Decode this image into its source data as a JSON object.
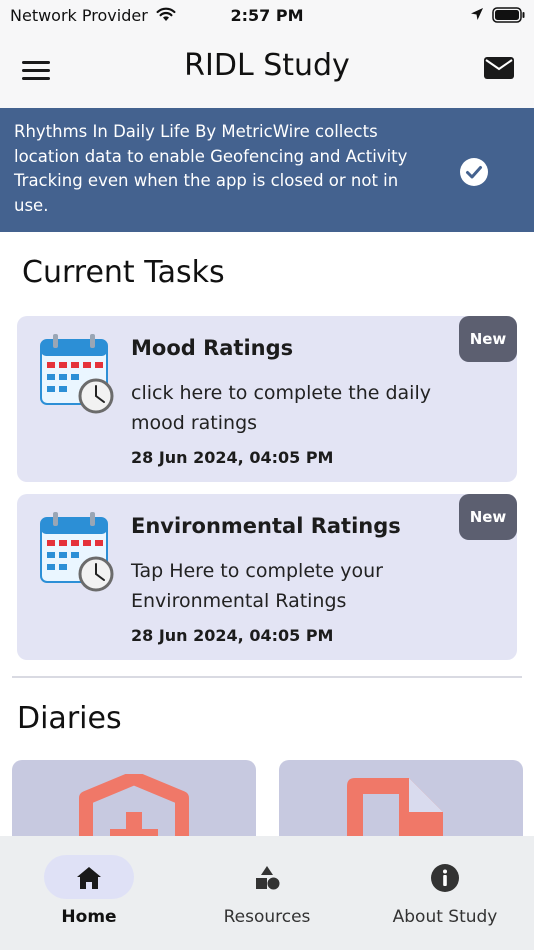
{
  "status_bar": {
    "carrier": "Network Provider",
    "time": "2:57 PM"
  },
  "header": {
    "title": "RIDL Study",
    "menu_icon": "hamburger-menu-icon",
    "mail_icon": "mail-icon"
  },
  "banner": {
    "text": "Rhythms In Daily Life By MetricWire collects location data to enable Geofencing and Activity Tracking even when the app is closed or not in use.",
    "background": "#44628f",
    "icon": "check-circle-icon"
  },
  "current_tasks": {
    "title": "Current Tasks",
    "tasks": [
      {
        "title": "Mood Ratings",
        "description": "click here to complete the daily mood ratings",
        "date": "28 Jun 2024, 04:05 PM",
        "badge": "New",
        "icon": "calendar-clock-icon"
      },
      {
        "title": "Environmental Ratings",
        "description": "Tap Here to complete your Environmental Ratings",
        "date": "28 Jun 2024, 04:05 PM",
        "badge": "New",
        "icon": "calendar-clock-icon"
      }
    ]
  },
  "diaries": {
    "title": "Diaries",
    "items": [
      {
        "icon": "medical-shield-icon"
      },
      {
        "icon": "document-icon"
      }
    ]
  },
  "tab_bar": {
    "tabs": [
      {
        "label": "Home",
        "icon": "home-icon",
        "active": true
      },
      {
        "label": "Resources",
        "icon": "shapes-icon",
        "active": false
      },
      {
        "label": "About Study",
        "icon": "info-icon",
        "active": false
      }
    ]
  },
  "colors": {
    "accent": "#44628f",
    "card": "#e3e4f4",
    "badge": "#5c5f70",
    "diary_icon": "#f07868"
  }
}
